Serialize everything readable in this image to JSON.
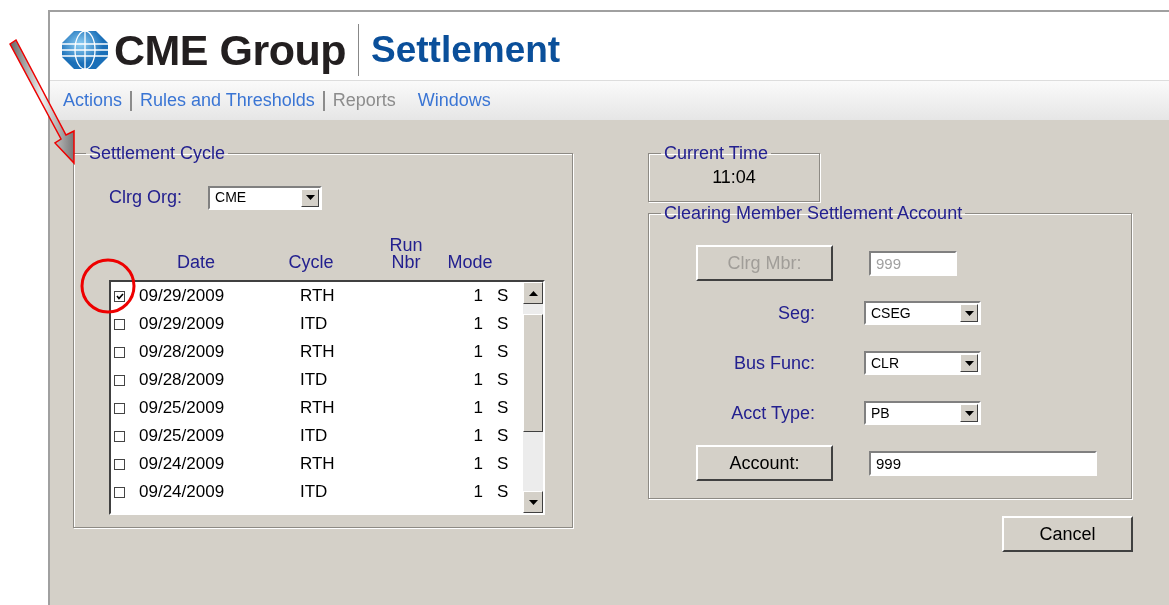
{
  "header": {
    "logo_text": "CME Group",
    "title": "Settlement"
  },
  "menu": [
    {
      "label": "Actions",
      "disabled": false,
      "divider": true
    },
    {
      "label": "Rules and Thresholds",
      "disabled": false,
      "divider": true
    },
    {
      "label": "Reports",
      "disabled": true,
      "divider": false
    },
    {
      "label": "Windows",
      "disabled": false,
      "divider": false
    }
  ],
  "settlement_cycle": {
    "title": "Settlement Cycle",
    "clrg_org": {
      "label": "Clrg Org:",
      "value": "CME"
    },
    "columns": [
      "Date",
      "Cycle",
      "Run Nbr",
      "Mode"
    ],
    "rows": [
      {
        "checked": true,
        "date": "09/29/2009",
        "cycle": "RTH",
        "run_nbr": "1",
        "mode": "S"
      },
      {
        "checked": false,
        "date": "09/29/2009",
        "cycle": "ITD",
        "run_nbr": "1",
        "mode": "S"
      },
      {
        "checked": false,
        "date": "09/28/2009",
        "cycle": "RTH",
        "run_nbr": "1",
        "mode": "S"
      },
      {
        "checked": false,
        "date": "09/28/2009",
        "cycle": "ITD",
        "run_nbr": "1",
        "mode": "S"
      },
      {
        "checked": false,
        "date": "09/25/2009",
        "cycle": "RTH",
        "run_nbr": "1",
        "mode": "S"
      },
      {
        "checked": false,
        "date": "09/25/2009",
        "cycle": "ITD",
        "run_nbr": "1",
        "mode": "S"
      },
      {
        "checked": false,
        "date": "09/24/2009",
        "cycle": "RTH",
        "run_nbr": "1",
        "mode": "S"
      },
      {
        "checked": false,
        "date": "09/24/2009",
        "cycle": "ITD",
        "run_nbr": "1",
        "mode": "S"
      }
    ]
  },
  "current_time": {
    "title": "Current Time",
    "value": "11:04"
  },
  "account": {
    "title": "Clearing Member Settlement Account",
    "fields": [
      {
        "kind": "button-input",
        "label": "Clrg Mbr:",
        "value": "999",
        "disabled": true
      },
      {
        "kind": "select",
        "label": "Seg:",
        "value": "CSEG"
      },
      {
        "kind": "select",
        "label": "Bus Func:",
        "value": "CLR"
      },
      {
        "kind": "select",
        "label": "Acct Type:",
        "value": "PB"
      },
      {
        "kind": "button-input",
        "label": "Account:",
        "value": "999",
        "disabled": false,
        "wide": true
      }
    ]
  },
  "buttons": [
    {
      "label": "Cancel"
    }
  ]
}
